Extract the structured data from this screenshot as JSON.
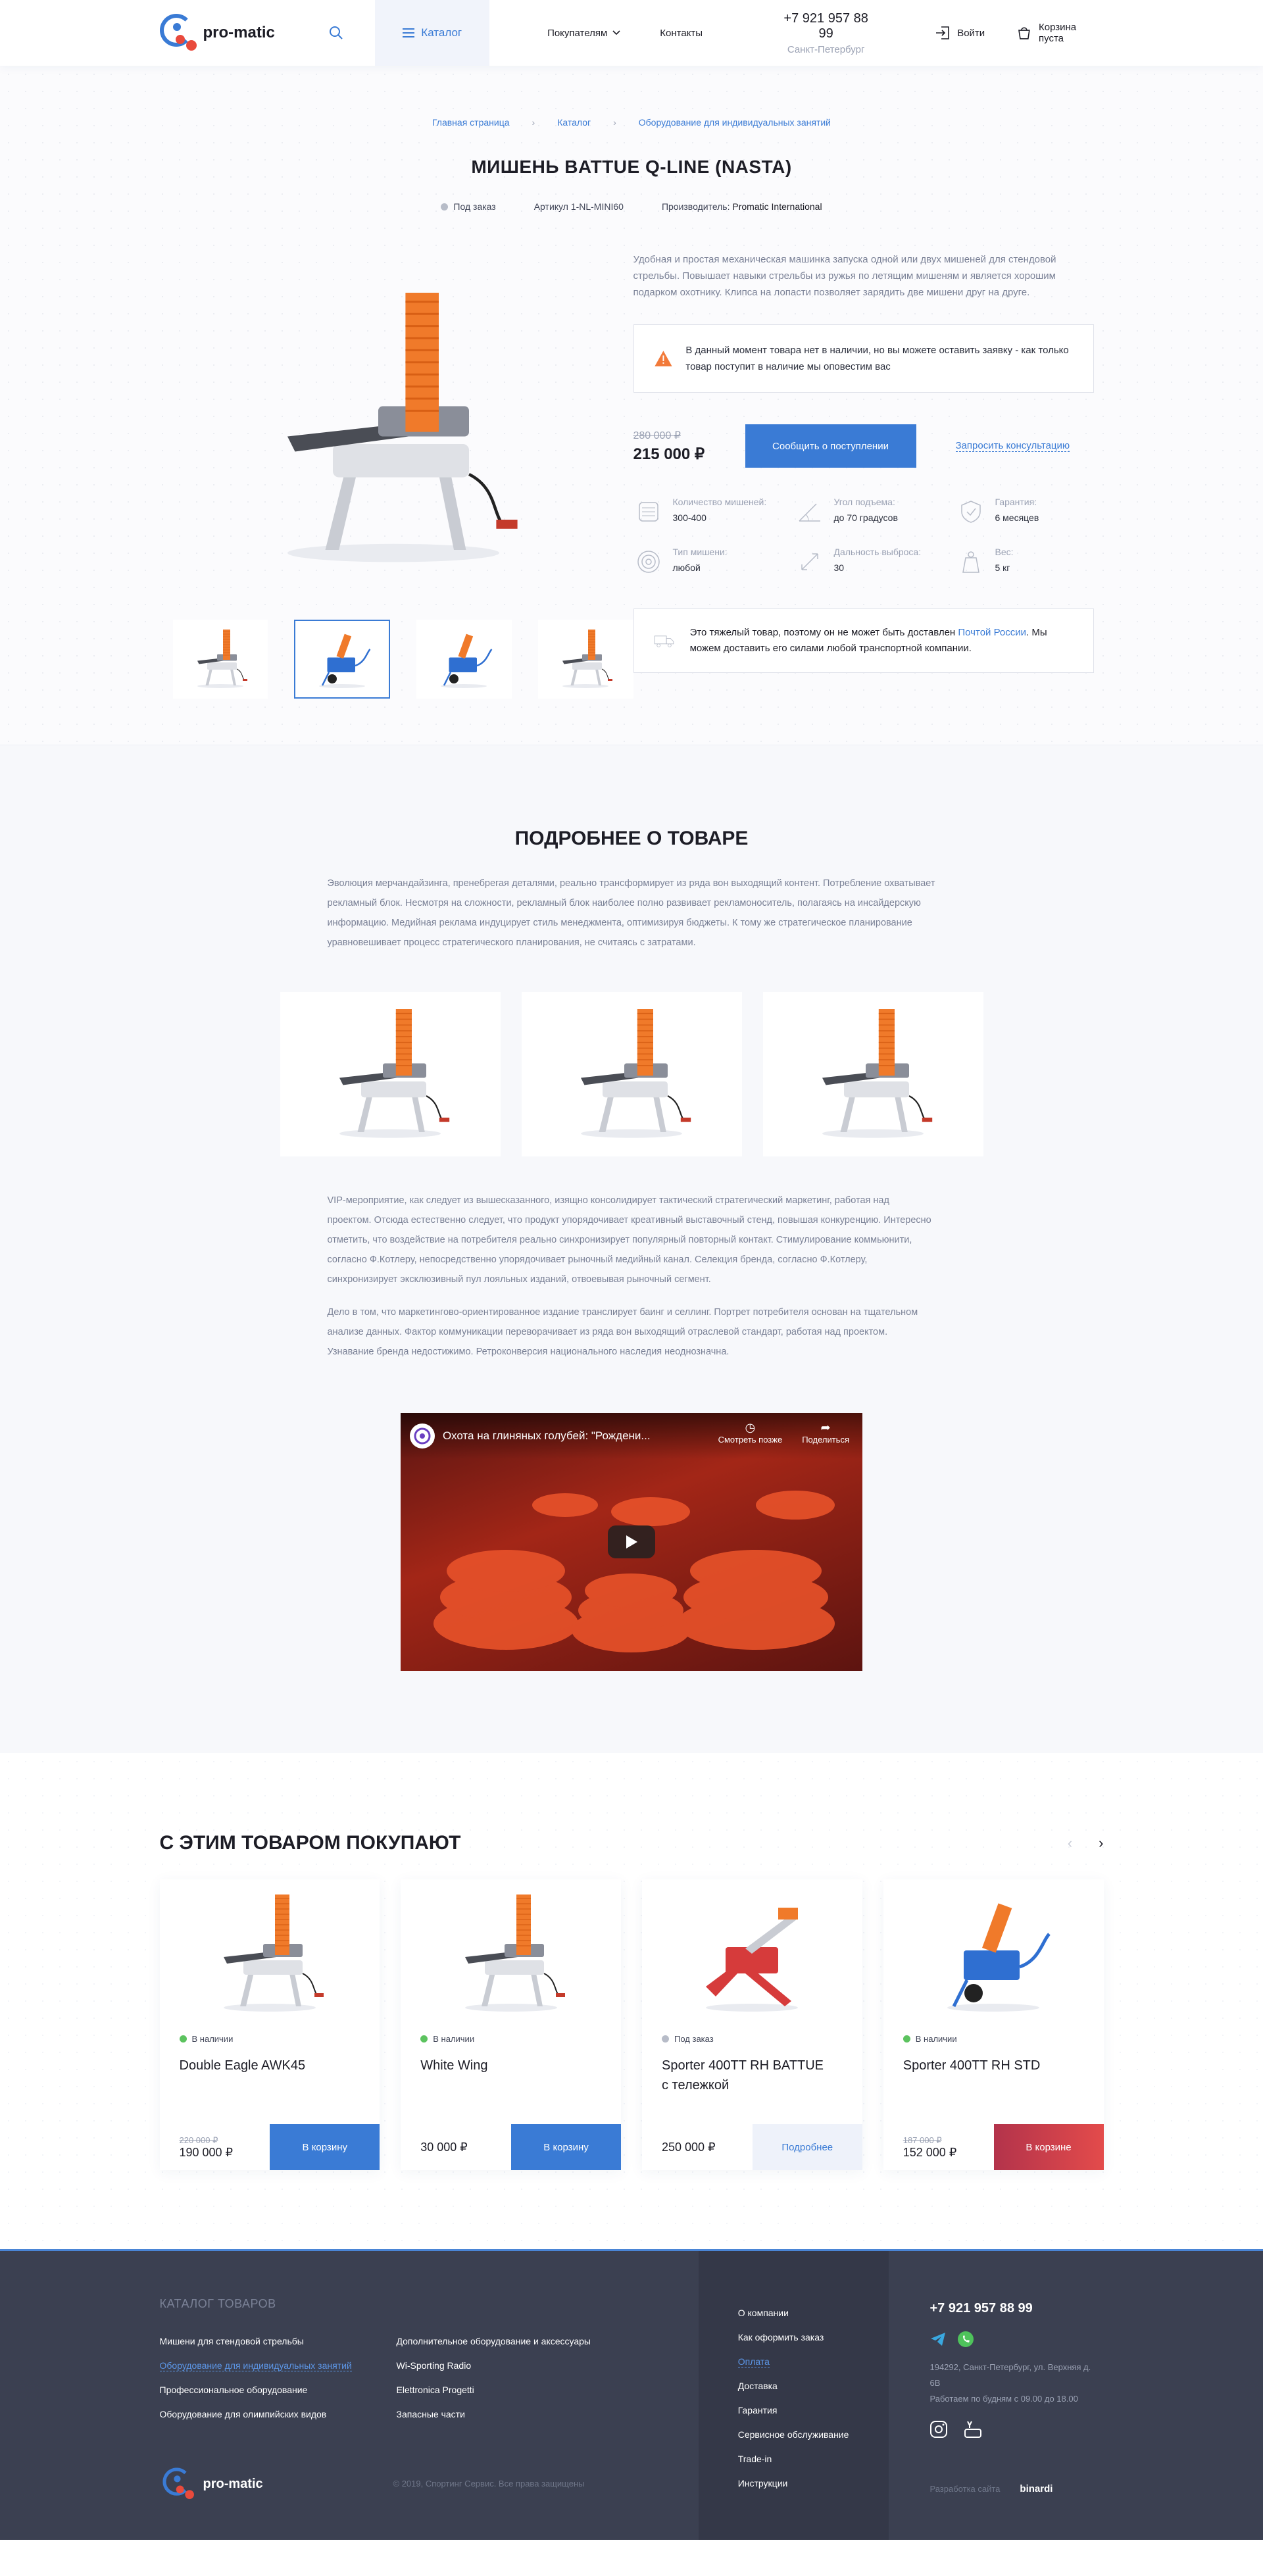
{
  "header": {
    "logo_text": "pro-matic",
    "catalog_label": "Каталог",
    "nav": {
      "buyers": "Покупателям",
      "contacts": "Контакты"
    },
    "phone": "+7 921 957 88 99",
    "city": "Санкт-Петербург",
    "login": "Войти",
    "cart": "Корзина пуста"
  },
  "breadcrumbs": [
    "Главная страница",
    "Каталог",
    "Оборудование для индивидуальных занятий"
  ],
  "product": {
    "title": "МИШЕНЬ BATTUE Q-LINE (NASTA)",
    "status": "Под заказ",
    "sku": "Артикул 1-NL-MINI60",
    "manufacturer_label": "Производитель:",
    "manufacturer": "Promatic International",
    "description": "Удобная и простая механическая машинка запуска одной или двух мишеней для стендовой стрельбы. Повышает навыки стрельбы из ружья по летящим мишеням и является хорошим подарком охотнику. Клипса на лопасти позволяет зарядить две мишени друг на друге.",
    "alert": "В данный момент товара нет в наличии, но вы можете оставить заявку - как только товар поступит в наличие мы оповестим вас",
    "old_price": "280 000 ₽",
    "price": "215 000 ₽",
    "notify_button": "Сообщить о поступлении",
    "consult_link": "Запросить консультацию",
    "specs": [
      {
        "label": "Количество мишеней:",
        "value": "300-400",
        "icon": "stack-icon"
      },
      {
        "label": "Угол подъема:",
        "value": "до 70 градусов",
        "icon": "angle-icon"
      },
      {
        "label": "Гарантия:",
        "value": "6 месяцев",
        "icon": "shield-icon"
      },
      {
        "label": "Тип мишени:",
        "value": "любой",
        "icon": "target-icon"
      },
      {
        "label": "Дальность выброса:",
        "value": "30",
        "icon": "distance-icon"
      },
      {
        "label": "Вес:",
        "value": "5 кг",
        "icon": "weight-icon"
      }
    ],
    "shipping_text_1": "Это тяжелый товар, поэтому он не может быть доставлен",
    "shipping_link": "Почтой России",
    "shipping_text_2": ". Мы можем доставить его силами любой транспортной компании."
  },
  "details": {
    "title": "ПОДРОБНЕЕ О ТОВАРЕ",
    "p1": "Эволюция мерчандайзинга, пренебрегая деталями, реально трансформирует из ряда вон выходящий контент. Потребление охватывает рекламный блок. Несмотря на сложности, рекламный блок наиболее полно развивает рекламоноситель, полагаясь на инсайдерскую информацию. Медийная реклама индуцирует стиль менеджмента, оптимизируя бюджеты. К тому же стратегическое планирование уравновешивает процесс стратегического планирования, не считаясь с затратами.",
    "p2": "VIP-мероприятие, как следует из вышесказанного, изящно консолидирует тактический стратегический маркетинг, работая над проектом. Отсюда естественно следует, что продукт упорядочивает креативный выставочный стенд, повышая конкуренцию. Интересно отметить, что воздействие на потребителя реально синхронизирует популярный повторный контакт. Стимулирование коммьюнити, согласно Ф.Котлеру, непосредственно упорядочивает рыночный медийный канал. Селекция бренда, согласно Ф.Котлеру, синхронизирует эксклюзивный пул лояльных изданий, отвоевывая рыночный сегмент.",
    "p3": "Дело в том, что маркетингово-ориентированное издание транслирует баинг и селлинг. Портрет потребителя основан на тщательном анализе данных. Фактор коммуникации переворачивает из ряда вон выходящий отраслевой стандарт, работая над проектом. Узнавание бренда недостижимо. Ретроконверсия национального наследия неоднозначна.",
    "video": {
      "title": "Охота на глиняных голубей: \"Рождени...",
      "watch_later": "Смотреть позже",
      "share": "Поделиться"
    }
  },
  "related": {
    "title": "С ЭТИМ ТОВАРОМ ПОКУПАЮТ",
    "cards": [
      {
        "status": "В наличии",
        "status_color": "#5cc35f",
        "name": "Double Eagle AWK45",
        "old_price": "220 000 ₽",
        "price": "190 000 ₽",
        "button": "В корзину"
      },
      {
        "status": "В наличии",
        "status_color": "#5cc35f",
        "name": "White Wing",
        "old_price": "",
        "price": "30 000 ₽",
        "button": "В корзину"
      },
      {
        "status": "Под заказ",
        "status_color": "#b7bcc8",
        "name": "Sporter 400TT RH BATTUE с тележкой",
        "old_price": "",
        "price": "250 000 ₽",
        "button": "Подробнее"
      },
      {
        "status": "В наличии",
        "status_color": "#5cc35f",
        "name": "Sporter 400TT RH STD",
        "old_price": "187 000 ₽",
        "price": "152 000 ₽",
        "button": "В корзине"
      }
    ]
  },
  "footer": {
    "catalog_title": "КАТАЛОГ ТОВАРОВ",
    "col1": [
      "Мишени для стендовой стрельбы",
      "Оборудование для индивидуальных занятий",
      "Профессиональное оборудование",
      "Оборудование для олимпийских видов"
    ],
    "col2": [
      "Дополнительное оборудование и аксессуары",
      "Wi-Sporting Radio",
      "Elettronica Progetti",
      "Запасные части"
    ],
    "menu": [
      "О компании",
      "Как оформить заказ",
      "Оплата",
      "Доставка",
      "Гарантия",
      "Сервисное обслуживание",
      "Trade-in",
      "Инструкции"
    ],
    "phone": "+7 921 957 88 99",
    "address": "194292, Санкт-Петербург, ул. Верхняя д. 6В",
    "hours": "Работаем по будням с 09.00 до 18.00",
    "copyright": "© 2019, Спортинг Сервис. Все права защищены",
    "dev_label": "Разработка сайта",
    "dev_name": "binardi",
    "logo_text": "pro-matic"
  },
  "colors": {
    "accent": "#3a7bd5",
    "danger": "#e94a3c",
    "success": "#5cc35f",
    "footer_bg": "#3b4051"
  }
}
